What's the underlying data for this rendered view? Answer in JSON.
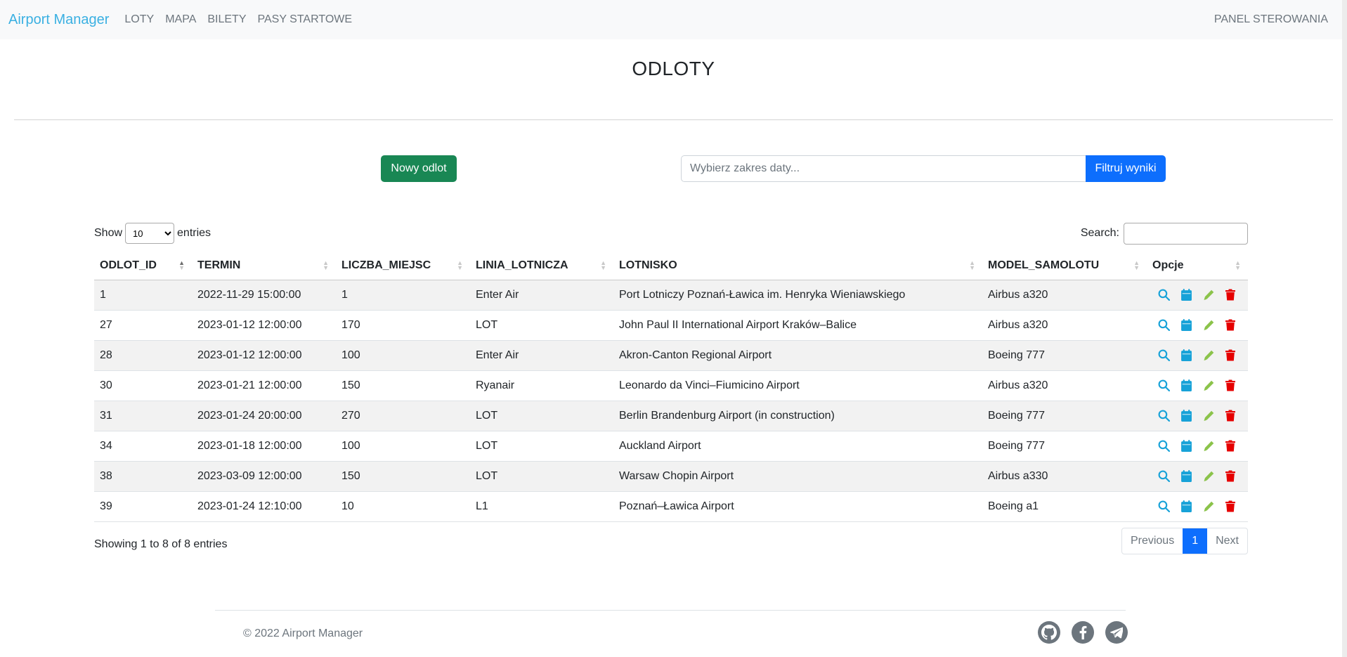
{
  "nav": {
    "brand": "Airport Manager",
    "links": [
      "LOTY",
      "MAPA",
      "BILETY",
      "PASY STARTOWE"
    ],
    "right": "PANEL STEROWANIA"
  },
  "page": {
    "title": "ODLOTY"
  },
  "actions": {
    "new_label": "Nowy odlot",
    "date_placeholder": "Wybierz zakres daty...",
    "filter_label": "Filtruj wyniki"
  },
  "table": {
    "show_label": "Show",
    "entries_label": "entries",
    "page_length": "10",
    "search_label": "Search:",
    "columns": [
      "ODLOT_ID",
      "TERMIN",
      "LICZBA_MIEJSC",
      "LINIA_LOTNICZA",
      "LOTNISKO",
      "MODEL_SAMOLOTU",
      "Opcje"
    ],
    "rows": [
      [
        "1",
        "2022-11-29 15:00:00",
        "1",
        "Enter Air",
        "Port Lotniczy Poznań-Ławica im. Henryka Wieniawskiego",
        "Airbus a320"
      ],
      [
        "27",
        "2023-01-12 12:00:00",
        "170",
        "LOT",
        "John Paul II International Airport Kraków–Balice",
        "Airbus a320"
      ],
      [
        "28",
        "2023-01-12 12:00:00",
        "100",
        "Enter Air",
        "Akron-Canton Regional Airport",
        "Boeing 777"
      ],
      [
        "30",
        "2023-01-21 12:00:00",
        "150",
        "Ryanair",
        "Leonardo da Vinci–Fiumicino Airport",
        "Airbus a320"
      ],
      [
        "31",
        "2023-01-24 20:00:00",
        "270",
        "LOT",
        "Berlin Brandenburg Airport (in construction)",
        "Boeing 777"
      ],
      [
        "34",
        "2023-01-18 12:00:00",
        "100",
        "LOT",
        "Auckland Airport",
        "Boeing 777"
      ],
      [
        "38",
        "2023-03-09 12:00:00",
        "150",
        "LOT",
        "Warsaw Chopin Airport",
        "Airbus a330"
      ],
      [
        "39",
        "2023-01-24 12:10:00",
        "10",
        "L1",
        "Poznań–Ławica Airport",
        "Boeing a1"
      ]
    ],
    "row_icons": [
      "search-icon",
      "calendar-icon",
      "pencil-icon",
      "trash-icon"
    ],
    "info": "Showing 1 to 8 of 8 entries",
    "pagination": {
      "previous": "Previous",
      "current": "1",
      "next": "Next"
    }
  },
  "footer": {
    "copyright": "© 2022 Airport Manager",
    "socials": [
      "github-icon",
      "facebook-icon",
      "telegram-icon"
    ]
  },
  "colors": {
    "brand": "#3ab0e2",
    "success": "#198754",
    "primary": "#0d6efd",
    "icon_search": "#17a2d8",
    "icon_calendar": "#17a2d8",
    "icon_edit": "#8bc34a",
    "icon_delete": "#e60000"
  }
}
